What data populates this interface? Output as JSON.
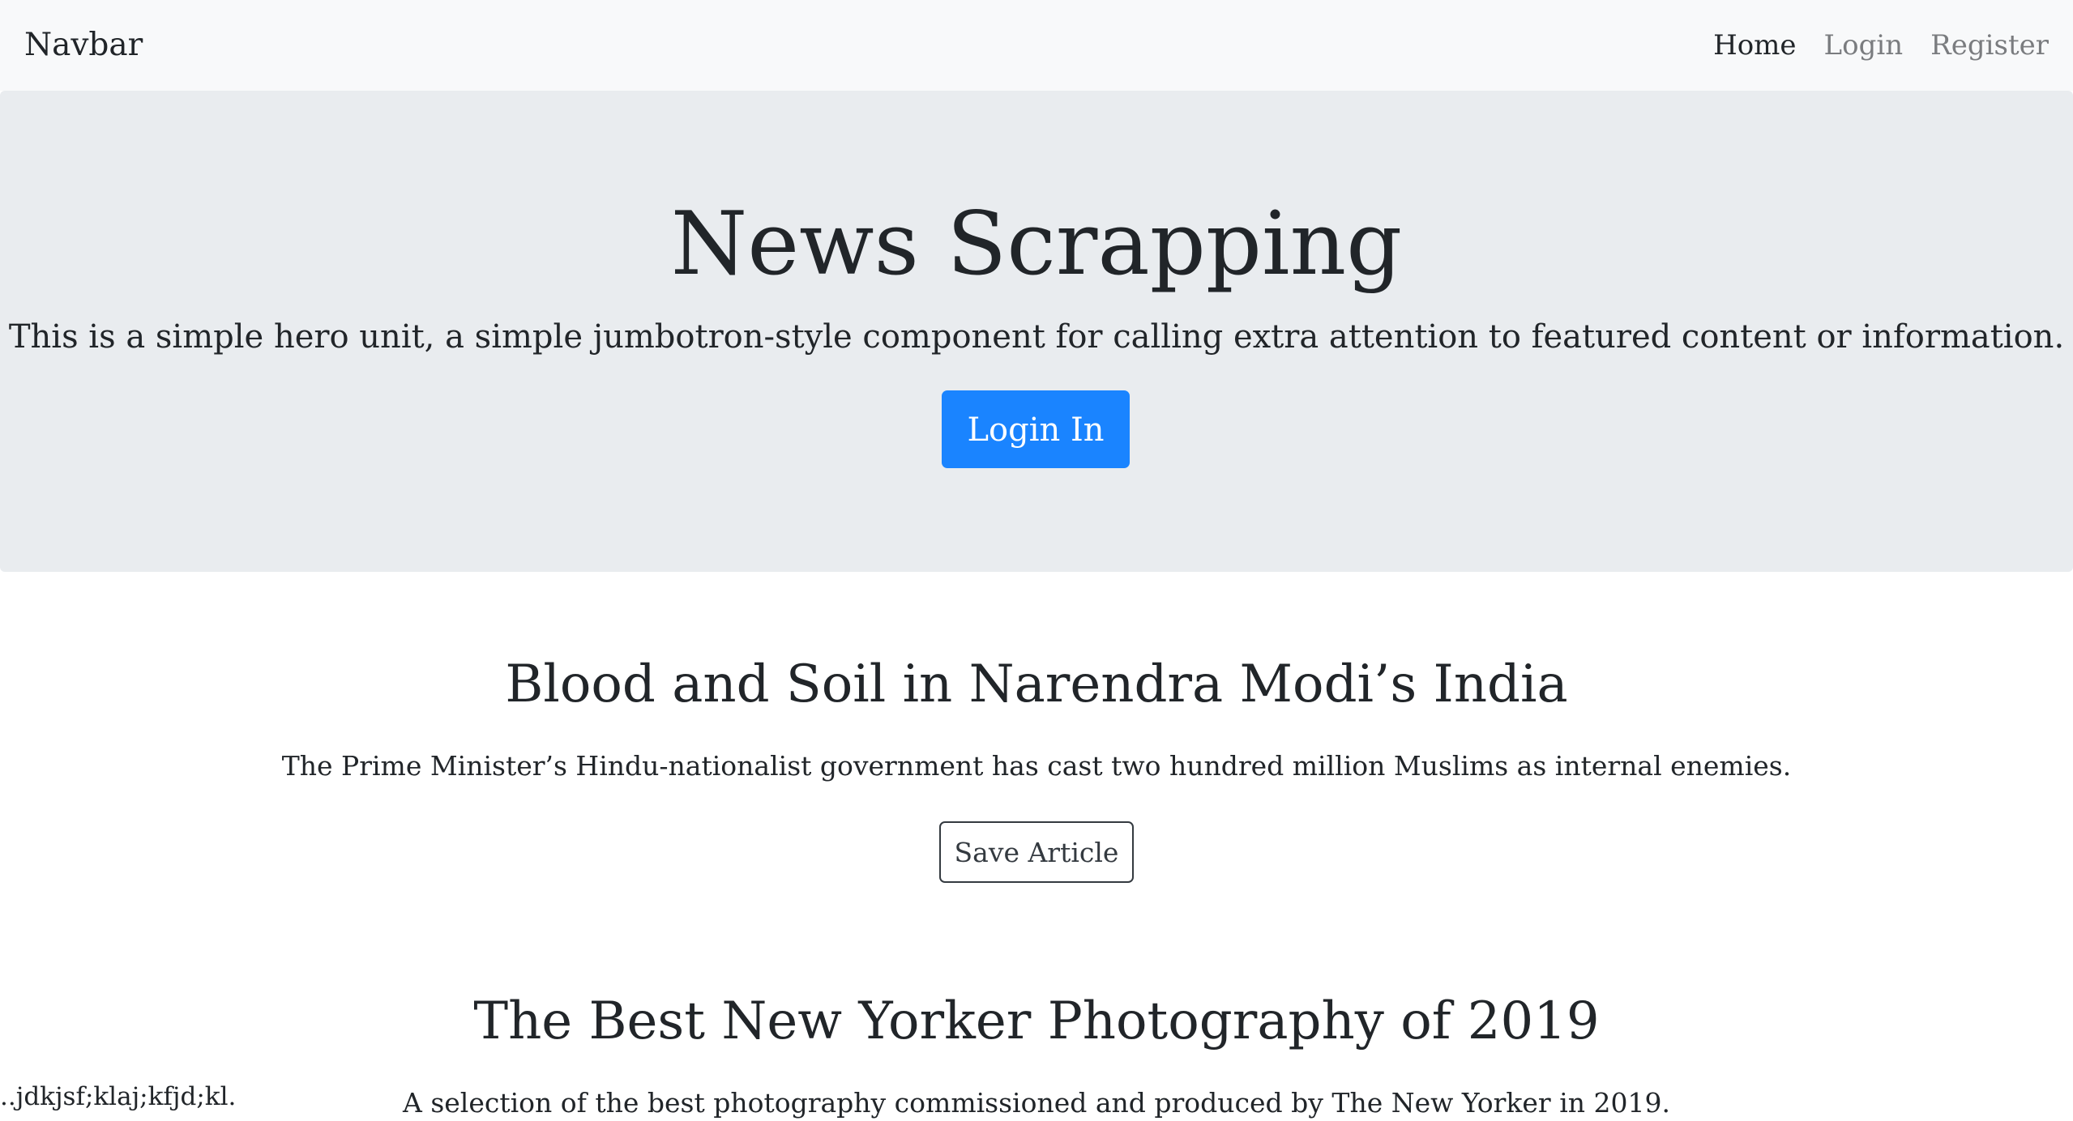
{
  "navbar": {
    "brand": "Navbar",
    "links": [
      {
        "label": "Home",
        "active": true
      },
      {
        "label": "Login",
        "active": false
      },
      {
        "label": "Register",
        "active": false
      }
    ]
  },
  "hero": {
    "title": "News Scrapping",
    "lead": "This is a simple hero unit, a simple jumbotron-style component for calling extra attention to featured content or information.",
    "button_label": "Login In"
  },
  "articles": [
    {
      "title": "Blood and Soil in Narendra Modi’s India",
      "description": "The Prime Minister’s Hindu-nationalist government has cast two hundred million Muslims as internal enemies.",
      "button_label": "Save Article"
    },
    {
      "title": "The Best New Yorker Photography of 2019",
      "description": "A selection of the best photography commissioned and produced by The New Yorker in 2019."
    }
  ],
  "stray_text": "..jdkjsf;klaj;kfjd;kl.",
  "colors": {
    "navbar_bg": "#f8f9fa",
    "jumbotron_bg": "#e9ecef",
    "primary": "#1a84ff",
    "text": "#212529",
    "muted_link": "#7a7c7f"
  }
}
